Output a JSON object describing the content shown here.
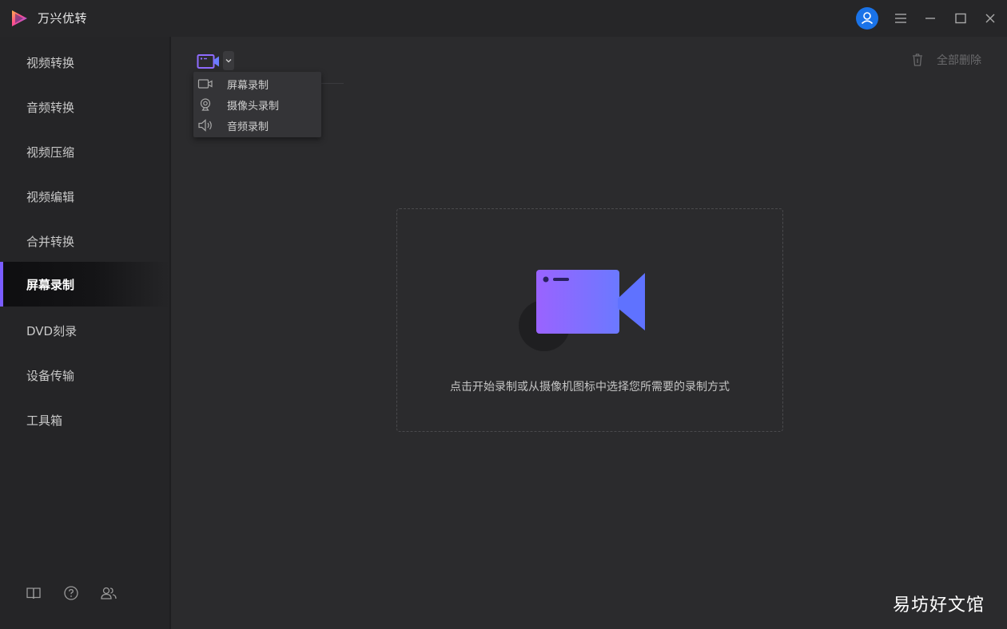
{
  "app": {
    "name": "万兴优转"
  },
  "titlebar": {
    "icons": [
      "avatar-icon",
      "menu-icon",
      "minimize-icon",
      "maximize-icon",
      "close-icon"
    ]
  },
  "sidebar": {
    "items": [
      {
        "label": "视频转换",
        "active": false
      },
      {
        "label": "音频转换",
        "active": false
      },
      {
        "label": "视频压缩",
        "active": false
      },
      {
        "label": "视频编辑",
        "active": false
      },
      {
        "label": "合并转换",
        "active": false
      },
      {
        "label": "屏幕录制",
        "active": true
      },
      {
        "label": "DVD刻录",
        "active": false
      },
      {
        "label": "设备传输",
        "active": false
      },
      {
        "label": "工具箱",
        "active": false
      }
    ],
    "footer_icons": [
      "guide-book-icon",
      "help-icon",
      "community-icon"
    ]
  },
  "toolbar": {
    "delete_all_label": "全部删除"
  },
  "record_menu": {
    "items": [
      {
        "label": "屏幕录制",
        "icon": "video-icon"
      },
      {
        "label": "摄像头录制",
        "icon": "webcam-icon"
      },
      {
        "label": "音频录制",
        "icon": "speaker-icon"
      }
    ]
  },
  "dropzone": {
    "hint": "点击开始录制或从摄像机图标中选择您所需要的录制方式"
  },
  "colors": {
    "accent": "#7a5cff",
    "background": "#2b2b2d",
    "sidebar": "#252527",
    "avatar": "#1a73e8"
  },
  "watermark": "易坊好文馆"
}
